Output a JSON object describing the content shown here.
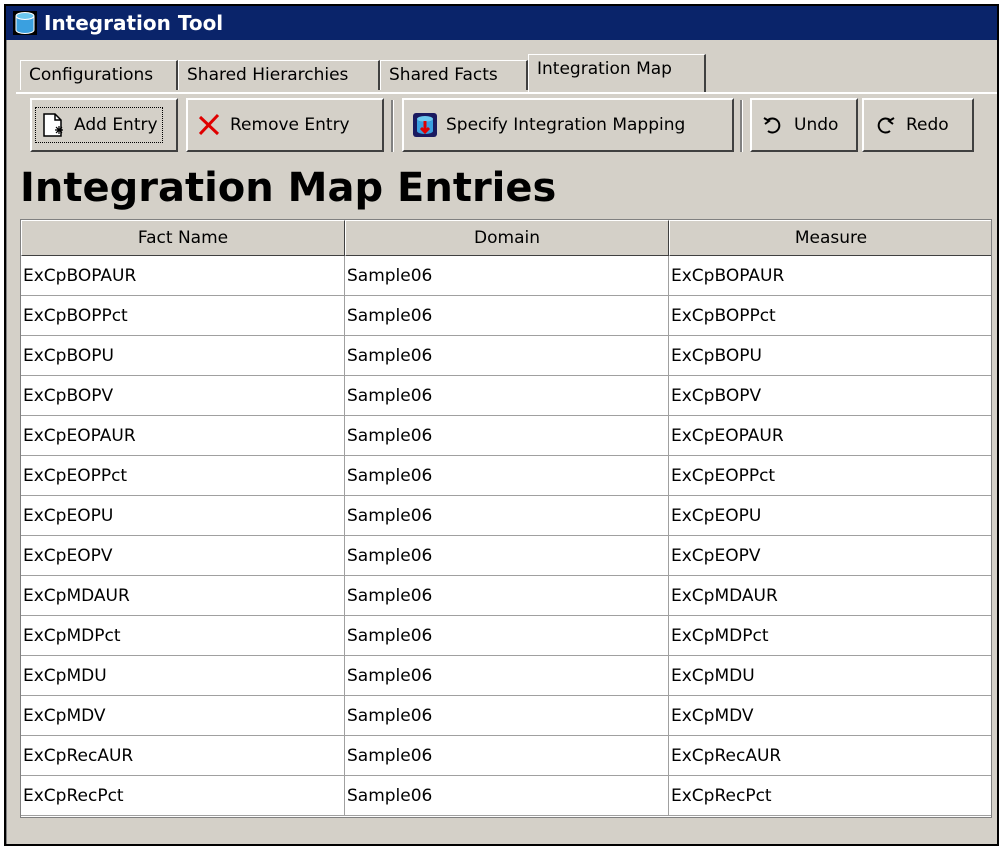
{
  "window": {
    "title": "Integration Tool"
  },
  "tabs": [
    {
      "label": "Configurations"
    },
    {
      "label": "Shared Hierarchies"
    },
    {
      "label": "Shared Facts"
    },
    {
      "label": "Integration Map",
      "active": true
    }
  ],
  "toolbar": {
    "add_label": "Add Entry",
    "remove_label": "Remove Entry",
    "specify_label": "Specify Integration Mapping",
    "undo_label": "Undo",
    "redo_label": "Redo"
  },
  "main": {
    "heading": "Integration Map Entries"
  },
  "table": {
    "columns": [
      "Fact Name",
      "Domain",
      "Measure"
    ],
    "rows": [
      [
        "ExCpBOPAUR",
        "Sample06",
        "ExCpBOPAUR"
      ],
      [
        "ExCpBOPPct",
        "Sample06",
        "ExCpBOPPct"
      ],
      [
        "ExCpBOPU",
        "Sample06",
        "ExCpBOPU"
      ],
      [
        "ExCpBOPV",
        "Sample06",
        "ExCpBOPV"
      ],
      [
        "ExCpEOPAUR",
        "Sample06",
        "ExCpEOPAUR"
      ],
      [
        "ExCpEOPPct",
        "Sample06",
        "ExCpEOPPct"
      ],
      [
        "ExCpEOPU",
        "Sample06",
        "ExCpEOPU"
      ],
      [
        "ExCpEOPV",
        "Sample06",
        "ExCpEOPV"
      ],
      [
        "ExCpMDAUR",
        "Sample06",
        "ExCpMDAUR"
      ],
      [
        "ExCpMDPct",
        "Sample06",
        "ExCpMDPct"
      ],
      [
        "ExCpMDU",
        "Sample06",
        "ExCpMDU"
      ],
      [
        "ExCpMDV",
        "Sample06",
        "ExCpMDV"
      ],
      [
        "ExCpRecAUR",
        "Sample06",
        "ExCpRecAUR"
      ],
      [
        "ExCpRecPct",
        "Sample06",
        "ExCpRecPct"
      ]
    ]
  },
  "colors": {
    "titlebar": "#0a246a",
    "face": "#d4d0c8",
    "remove_icon": "#e00000"
  }
}
